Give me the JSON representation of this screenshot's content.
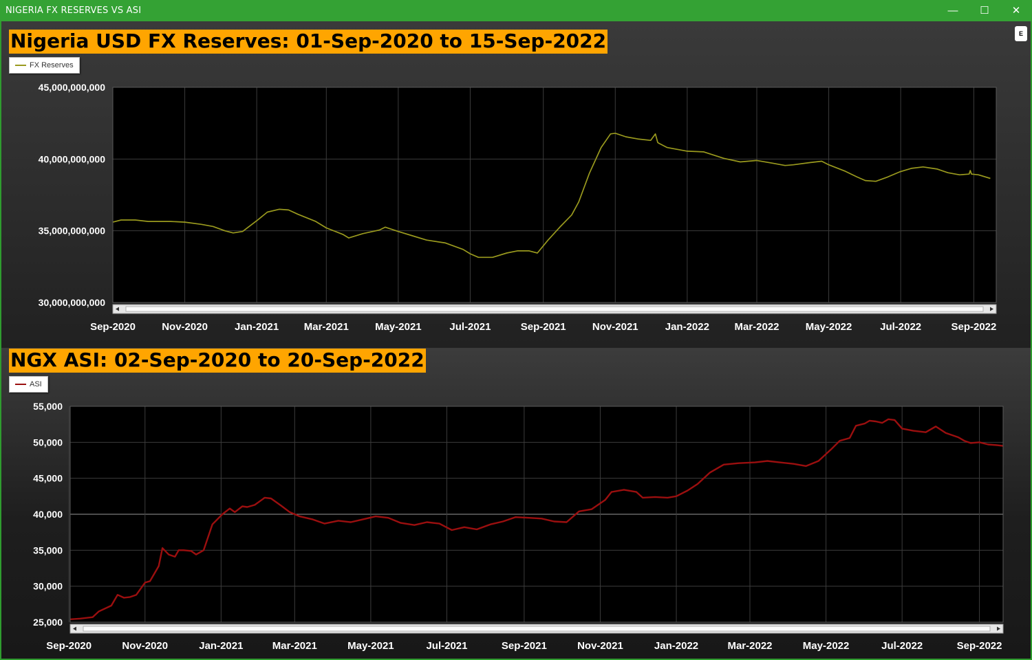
{
  "window": {
    "title": "NIGERIA FX RESERVES VS ASI",
    "minimize_glyph": "—",
    "maximize_glyph": "☐",
    "close_glyph": "✕"
  },
  "toolbar": {
    "e_label": "E"
  },
  "colors": {
    "titlebar": "#34a234",
    "title_bg": "#ffa500",
    "fx_line": "#9a9a1e",
    "asi_line": "#9b0f0f"
  },
  "chart_data": [
    {
      "type": "line",
      "title": "Nigeria USD FX Reserves: 01-Sep-2020 to 15-Sep-2022",
      "series": [
        {
          "name": "FX Reserves",
          "x": [
            "2020-09-01",
            "2020-09-08",
            "2020-09-20",
            "2020-10-01",
            "2020-10-20",
            "2020-11-01",
            "2020-11-15",
            "2020-11-25",
            "2020-12-05",
            "2020-12-12",
            "2020-12-20",
            "2021-01-01",
            "2021-01-10",
            "2021-01-20",
            "2021-01-28",
            "2021-02-05",
            "2021-02-20",
            "2021-03-01",
            "2021-03-15",
            "2021-03-20",
            "2021-04-01",
            "2021-04-15",
            "2021-04-20",
            "2021-05-01",
            "2021-05-15",
            "2021-05-25",
            "2021-06-10",
            "2021-06-25",
            "2021-07-01",
            "2021-07-08",
            "2021-07-20",
            "2021-08-01",
            "2021-08-10",
            "2021-08-20",
            "2021-08-27",
            "2021-09-05",
            "2021-09-15",
            "2021-09-25",
            "2021-10-01",
            "2021-10-10",
            "2021-10-20",
            "2021-10-28",
            "2021-11-01",
            "2021-11-10",
            "2021-11-20",
            "2021-12-01",
            "2021-12-05",
            "2021-12-07",
            "2021-12-08",
            "2021-12-15",
            "2022-01-01",
            "2022-01-15",
            "2022-02-01",
            "2022-02-15",
            "2022-03-01",
            "2022-03-15",
            "2022-03-25",
            "2022-04-01",
            "2022-04-15",
            "2022-04-25",
            "2022-05-01",
            "2022-05-15",
            "2022-05-25",
            "2022-06-01",
            "2022-06-10",
            "2022-06-20",
            "2022-06-30",
            "2022-07-10",
            "2022-07-20",
            "2022-08-01",
            "2022-08-10",
            "2022-08-20",
            "2022-08-28",
            "2022-08-29",
            "2022-08-30",
            "2022-09-05",
            "2022-09-15"
          ],
          "values": [
            35.6,
            35.75,
            35.75,
            35.65,
            35.65,
            35.6,
            35.45,
            35.3,
            35.0,
            34.85,
            34.95,
            35.7,
            36.3,
            36.5,
            36.45,
            36.15,
            35.65,
            35.2,
            34.75,
            34.5,
            34.8,
            35.05,
            35.25,
            34.95,
            34.6,
            34.35,
            34.15,
            33.7,
            33.4,
            33.15,
            33.15,
            33.45,
            33.6,
            33.6,
            33.45,
            34.35,
            35.25,
            36.1,
            37.0,
            39.0,
            40.8,
            41.75,
            41.8,
            41.55,
            41.4,
            41.3,
            41.75,
            41.15,
            41.1,
            40.8,
            40.55,
            40.5,
            40.05,
            39.8,
            39.9,
            39.7,
            39.55,
            39.6,
            39.75,
            39.85,
            39.6,
            39.15,
            38.75,
            38.5,
            38.45,
            38.75,
            39.1,
            39.35,
            39.45,
            39.3,
            39.05,
            38.9,
            38.95,
            39.2,
            38.95,
            38.9,
            38.65
          ]
        }
      ],
      "value_multiplier": 1000000000,
      "y_ticks": [
        "30,000,000,000",
        "35,000,000,000",
        "40,000,000,000",
        "45,000,000,000"
      ],
      "x_ticks": [
        "Sep-2020",
        "Nov-2020",
        "Jan-2021",
        "Mar-2021",
        "May-2021",
        "Jul-2021",
        "Sep-2021",
        "Nov-2021",
        "Jan-2022",
        "Mar-2022",
        "May-2022",
        "Jul-2022",
        "Sep-2022"
      ],
      "ylim": [
        30000000000,
        45000000000
      ],
      "grid": true,
      "legend": "top-left"
    },
    {
      "type": "line",
      "title": "NGX ASI: 02-Sep-2020 to 20-Sep-2022",
      "series": [
        {
          "name": "ASI",
          "x": [
            "2020-09-02",
            "2020-09-10",
            "2020-09-20",
            "2020-09-25",
            "2020-10-05",
            "2020-10-10",
            "2020-10-15",
            "2020-10-20",
            "2020-10-25",
            "2020-11-01",
            "2020-11-05",
            "2020-11-12",
            "2020-11-15",
            "2020-11-20",
            "2020-11-25",
            "2020-11-28",
            "2020-12-02",
            "2020-12-08",
            "2020-12-12",
            "2020-12-18",
            "2020-12-25",
            "2021-01-02",
            "2021-01-08",
            "2021-01-12",
            "2021-01-18",
            "2021-01-22",
            "2021-01-28",
            "2021-02-05",
            "2021-02-10",
            "2021-02-18",
            "2021-02-25",
            "2021-03-05",
            "2021-03-15",
            "2021-03-25",
            "2021-04-05",
            "2021-04-15",
            "2021-04-25",
            "2021-05-05",
            "2021-05-15",
            "2021-05-25",
            "2021-06-05",
            "2021-06-15",
            "2021-06-25",
            "2021-07-05",
            "2021-07-15",
            "2021-07-25",
            "2021-08-05",
            "2021-08-15",
            "2021-08-25",
            "2021-09-05",
            "2021-09-15",
            "2021-09-25",
            "2021-10-05",
            "2021-10-15",
            "2021-10-25",
            "2021-11-05",
            "2021-11-10",
            "2021-11-20",
            "2021-11-30",
            "2021-12-05",
            "2021-12-15",
            "2021-12-25",
            "2022-01-01",
            "2022-01-10",
            "2022-01-18",
            "2022-01-28",
            "2022-02-08",
            "2022-02-20",
            "2022-03-05",
            "2022-03-15",
            "2022-03-25",
            "2022-04-05",
            "2022-04-15",
            "2022-04-25",
            "2022-05-05",
            "2022-05-12",
            "2022-05-20",
            "2022-05-25",
            "2022-06-01",
            "2022-06-05",
            "2022-06-10",
            "2022-06-15",
            "2022-06-20",
            "2022-06-25",
            "2022-07-01",
            "2022-07-10",
            "2022-07-20",
            "2022-07-28",
            "2022-08-05",
            "2022-08-15",
            "2022-08-20",
            "2022-08-25",
            "2022-09-01",
            "2022-09-08",
            "2022-09-15",
            "2022-09-20"
          ],
          "values": [
            25400,
            25500,
            25700,
            26500,
            27300,
            28800,
            28400,
            28500,
            28800,
            30500,
            30700,
            32800,
            35300,
            34400,
            34100,
            35000,
            35000,
            34900,
            34400,
            35000,
            38600,
            40000,
            40800,
            40300,
            41100,
            41000,
            41300,
            42300,
            42200,
            41200,
            40300,
            39700,
            39300,
            38700,
            39100,
            38900,
            39300,
            39700,
            39500,
            38800,
            38500,
            38900,
            38700,
            37800,
            38200,
            37900,
            38600,
            39000,
            39600,
            39500,
            39400,
            39000,
            38900,
            40400,
            40700,
            42000,
            43100,
            43400,
            43100,
            42300,
            42400,
            42300,
            42500,
            43300,
            44200,
            45800,
            46900,
            47100,
            47200,
            47400,
            47200,
            47000,
            46700,
            47400,
            49000,
            50200,
            50600,
            52300,
            52600,
            53000,
            52900,
            52700,
            53200,
            53100,
            51900,
            51600,
            51400,
            52200,
            51300,
            50700,
            50200,
            49900,
            50000,
            49700,
            49600,
            49500
          ]
        }
      ],
      "y_ticks": [
        "25,000",
        "30,000",
        "35,000",
        "40,000",
        "45,000",
        "50,000",
        "55,000"
      ],
      "x_ticks": [
        "Sep-2020",
        "Nov-2020",
        "Jan-2021",
        "Mar-2021",
        "May-2021",
        "Jul-2021",
        "Sep-2021",
        "Nov-2021",
        "Jan-2022",
        "Mar-2022",
        "May-2022",
        "Jul-2022",
        "Sep-2022"
      ],
      "ylim": [
        25000,
        55000
      ],
      "grid": true,
      "legend": "top-left"
    }
  ]
}
